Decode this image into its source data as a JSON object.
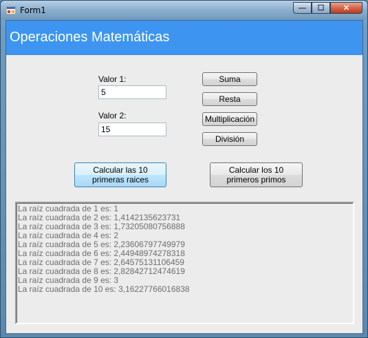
{
  "window": {
    "title": "Form1",
    "controls": {
      "minimize": "—",
      "maximize": "☐",
      "close": "✕"
    }
  },
  "header": {
    "title": "Operaciones Matemáticas",
    "color": "#3d95f1"
  },
  "inputs": {
    "valor1_label": "Valor 1:",
    "valor1_value": "5",
    "valor2_label": "Valor 2:",
    "valor2_value": "15"
  },
  "operations": {
    "suma": "Suma",
    "resta": "Resta",
    "multiplicacion": "Multiplicación",
    "division": "División"
  },
  "actions": {
    "raices": "Calcular las 10 primeras raices",
    "primos": "Calcular los 10 primeros primos"
  },
  "output": {
    "lines": [
      "La raíz cuadrada de 1 es: 1",
      "La raíz cuadrada de 2 es: 1,4142135623731",
      "La raíz cuadrada de 3 es: 1,73205080756888",
      "La raíz cuadrada de 4 es: 2",
      "La raíz cuadrada de 5 es: 2,23606797749979",
      "La raíz cuadrada de 6 es: 2,44948974278318",
      "La raíz cuadrada de 7 es: 2,64575131106459",
      "La raíz cuadrada de 8 es: 2,82842712474619",
      "La raíz cuadrada de 9 es: 3",
      "La raíz cuadrada de 10 es: 3,16227766016838"
    ]
  }
}
